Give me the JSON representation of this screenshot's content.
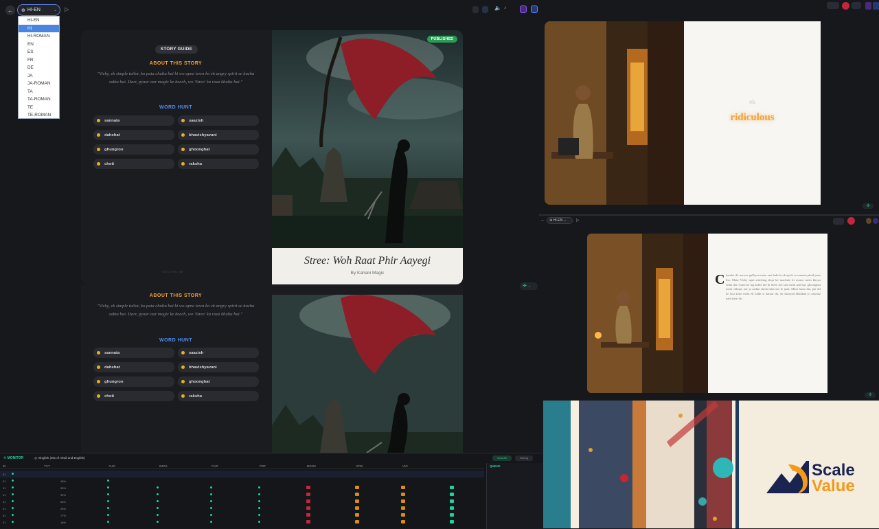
{
  "toolbar": {
    "language_current": "HI-EN",
    "language_options": [
      "HI-EN",
      "HI",
      "HI-ROMAN",
      "EN",
      "ES",
      "FR",
      "DE",
      "JA",
      "JA-ROMAN",
      "TA",
      "TA-ROMAN",
      "TE",
      "TE-ROMAN"
    ],
    "selected_option": "HI"
  },
  "card": {
    "guide_pill": "STORY GUIDE",
    "about_title": "ABOUT THIS STORY",
    "about_text": "\"Vicky, ek simple tailor, ko pata chalta hai ki wo apne town ko ek angry spirit se bacha sakta hai. Darr, pyaar aur magic ke beech, wo 'Stree' ka raaz khulta hai.\"",
    "word_hunt_title": "WORD HUNT",
    "words": [
      "sannata",
      "saazish",
      "dahshat",
      "bhavishyavani",
      "ghungroo",
      "ghoonghat",
      "choti",
      "raksha"
    ],
    "footer_id": "ISO-CARD_SB",
    "status_badge": "PUBLISHED",
    "cover_title": "Stree: Woh Raat Phir Aayegi",
    "cover_byline": "By Kahani Magic"
  },
  "right": {
    "word_small": "ek",
    "word_big": "ridiculous",
    "lang2": "HI-EN",
    "drop_cap": "C",
    "body_text": "handeri ki narrow galliyon mein raat bahi ki ek ajeeb sa sannata phail jaata tha. Main Vicky apni stitching shop ke machine ki awaaz mein khoya rehta tha. Gaon ke log kehte the ki Stree sirf raat mein aati hai, ghoonghat mein chhupi, aur jo aadmi akela mila use le jaati. Main hasta tha, par dil ke kisi kone mein ek halki si daraar thi, ek shaayad dhadkan jo aawaaz nahi karti thi."
  },
  "brand": {
    "line1": "Scale",
    "line2": "Value"
  },
  "monitor": {
    "title": "MONITOR",
    "subtitle": "Hinglish (Mix of Hindi and English)",
    "button1": "New All",
    "button2": "Debug",
    "columns": [
      "ID",
      "TXT",
      "AUD",
      "IMGS",
      "CVR",
      "PDF",
      "BOOK",
      "EPB",
      "VID"
    ],
    "queue_label": "QUEUE",
    "rows": [
      {
        "id": "01",
        "txt": "",
        "aud": ""
      },
      {
        "id": "01",
        "txt": "48%",
        "aud": ""
      },
      {
        "id": "01",
        "txt": "95%",
        "aud": ""
      },
      {
        "id": "01",
        "txt": "32%",
        "aud": ""
      },
      {
        "id": "01",
        "txt": "63%",
        "aud": ""
      },
      {
        "id": "01",
        "txt": "28%",
        "aud": ""
      },
      {
        "id": "01",
        "txt": "77%",
        "aud": ""
      },
      {
        "id": "01",
        "txt": "18%",
        "aud": ""
      }
    ]
  },
  "colors": {
    "accent_orange": "#f2a23a",
    "accent_blue": "#4f8ef7",
    "published_green": "#2a9b52",
    "monitor_green": "#1fd39a",
    "brand_navy": "#1a2450"
  }
}
